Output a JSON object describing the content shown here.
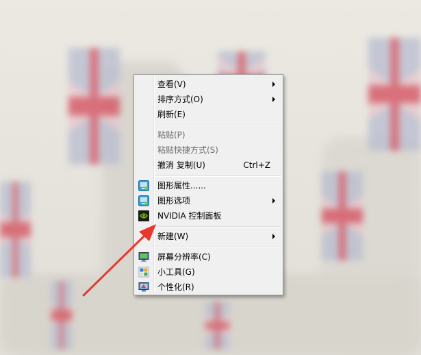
{
  "menu": {
    "items": [
      {
        "label": "查看(V)",
        "submenu": true,
        "disabled": false
      },
      {
        "label": "排序方式(O)",
        "submenu": true,
        "disabled": false
      },
      {
        "label": "刷新(E)",
        "submenu": false,
        "disabled": false
      },
      {
        "label": "粘贴(P)",
        "submenu": false,
        "disabled": true
      },
      {
        "label": "粘贴快捷方式(S)",
        "submenu": false,
        "disabled": true
      },
      {
        "label": "撤消 复制(U)",
        "shortcut": "Ctrl+Z",
        "submenu": false,
        "disabled": false
      },
      {
        "label": "图形属性......",
        "icon": "intel-graphics-icon",
        "submenu": false,
        "disabled": false
      },
      {
        "label": "图形选项",
        "icon": "intel-graphics-icon",
        "submenu": true,
        "disabled": false
      },
      {
        "label": "NVIDIA 控制面板",
        "icon": "nvidia-icon",
        "submenu": false,
        "disabled": false
      },
      {
        "label": "新建(W)",
        "submenu": true,
        "disabled": false
      },
      {
        "label": "屏幕分辨率(C)",
        "icon": "monitor-icon",
        "submenu": false,
        "disabled": false
      },
      {
        "label": "小工具(G)",
        "icon": "gadgets-icon",
        "submenu": false,
        "disabled": false
      },
      {
        "label": "个性化(R)",
        "icon": "personalize-icon",
        "submenu": false,
        "disabled": false
      }
    ]
  },
  "colors": {
    "annotation_arrow": "#e8372e",
    "menu_background": "#f0f0f0",
    "disabled_text": "#6d6d6d"
  }
}
